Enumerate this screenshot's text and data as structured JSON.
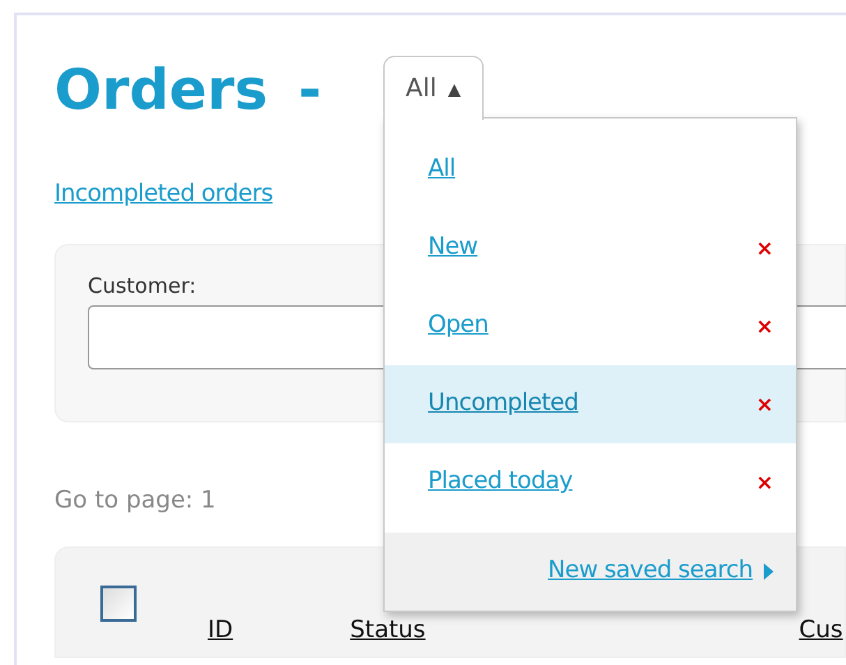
{
  "title": "Orders",
  "separator": "-",
  "view_dropdown": {
    "value": "All",
    "caret": "▲",
    "expanded": true
  },
  "menu": {
    "items": [
      {
        "label": "All",
        "selected": false,
        "deletable": false
      },
      {
        "label": "New",
        "selected": false,
        "deletable": true
      },
      {
        "label": "Open",
        "selected": false,
        "deletable": true
      },
      {
        "label": "Uncompleted",
        "selected": true,
        "deletable": true
      },
      {
        "label": "Placed today",
        "selected": false,
        "deletable": true
      }
    ],
    "delete_glyph": "×",
    "footer_link": "New saved search"
  },
  "incompleted_link": "Incompleted orders",
  "filter": {
    "customer_label": "Customer:"
  },
  "pager": "Go to page: 1",
  "table": {
    "select_all_checked": false,
    "columns": [
      "ID",
      "Status",
      "Cus"
    ]
  }
}
